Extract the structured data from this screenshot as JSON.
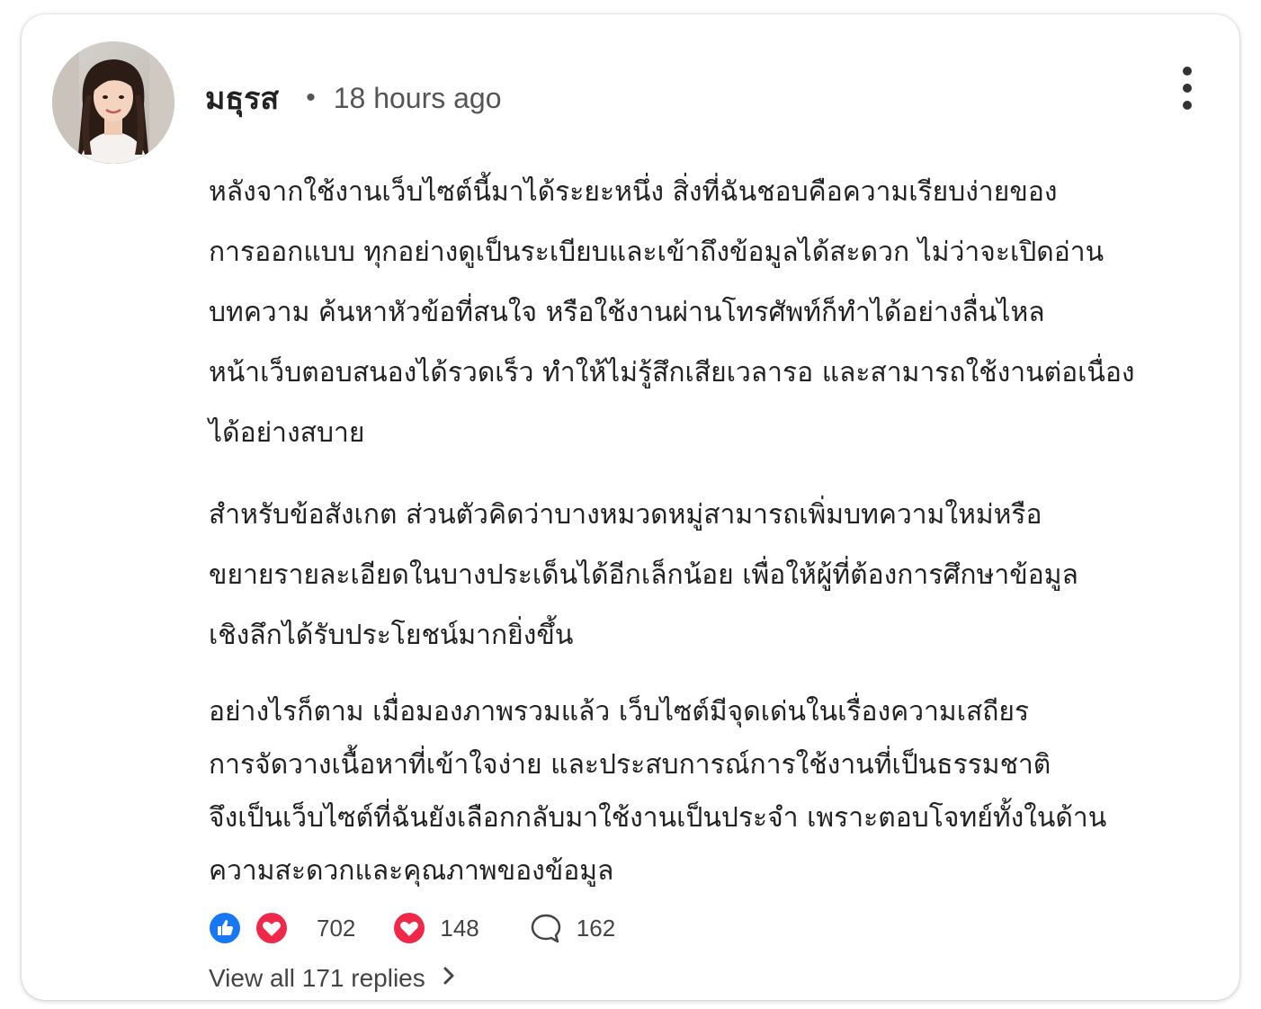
{
  "comment": {
    "author": "มธุรส",
    "separator": "•",
    "timestamp": "18 hours ago",
    "paragraphs": [
      [
        "หลังจากใช้งานเว็บไซต์นี้มาได้ระยะหนึ่ง สิ่งที่ฉันชอบคือความเรียบง่ายของ",
        "การออกแบบ ทุกอย่างดูเป็นระเบียบและเข้าถึงข้อมูลได้สะดวก ไม่ว่าจะเปิดอ่าน",
        "บทความ ค้นหาหัวข้อที่สนใจ หรือใช้งานผ่านโทรศัพท์ก็ทำได้อย่างลื่นไหล",
        "หน้าเว็บตอบสนองได้รวดเร็ว ทำให้ไม่รู้สึกเสียเวลารอ และสามารถใช้งานต่อเนื่อง",
        "ได้อย่างสบาย"
      ],
      [
        "สำหรับข้อสังเกต ส่วนตัวคิดว่าบางหมวดหมู่สามารถเพิ่มบทความใหม่หรือ",
        "ขยายรายละเอียดในบางประเด็นได้อีกเล็กน้อย เพื่อให้ผู้ที่ต้องการศึกษาข้อมูล",
        "เชิงลึกได้รับประโยชน์มากยิ่งขึ้น"
      ],
      [
        "อย่างไรก็ตาม เมื่อมองภาพรวมแล้ว เว็บไซต์มีจุดเด่นในเรื่องความเสถียร",
        "การจัดวางเนื้อหาที่เข้าใจง่าย และประสบการณ์การใช้งานที่เป็นธรรมชาติ",
        "จึงเป็นเว็บไซต์ที่ฉันยังเลือกกลับมาใช้งานเป็นประจำ เพราะตอบโจทย์ทั้งในด้าน",
        "ความสะดวกและคุณภาพของข้อมูล"
      ]
    ]
  },
  "reactions": {
    "like_icon": "thumbs-up-icon",
    "heart_icon": "heart-icon",
    "reaction_count": "702",
    "love_count": "148",
    "comment_icon": "comment-bubble-icon",
    "comment_count": "162"
  },
  "replies": {
    "label": "View all 171 replies",
    "icon": "chevron-right-icon"
  },
  "menu": {
    "icon": "more-vertical-icon"
  },
  "colors": {
    "like_blue": "#1877f2",
    "heart_red": "#f02849",
    "text": "#222222",
    "muted": "#555555"
  }
}
